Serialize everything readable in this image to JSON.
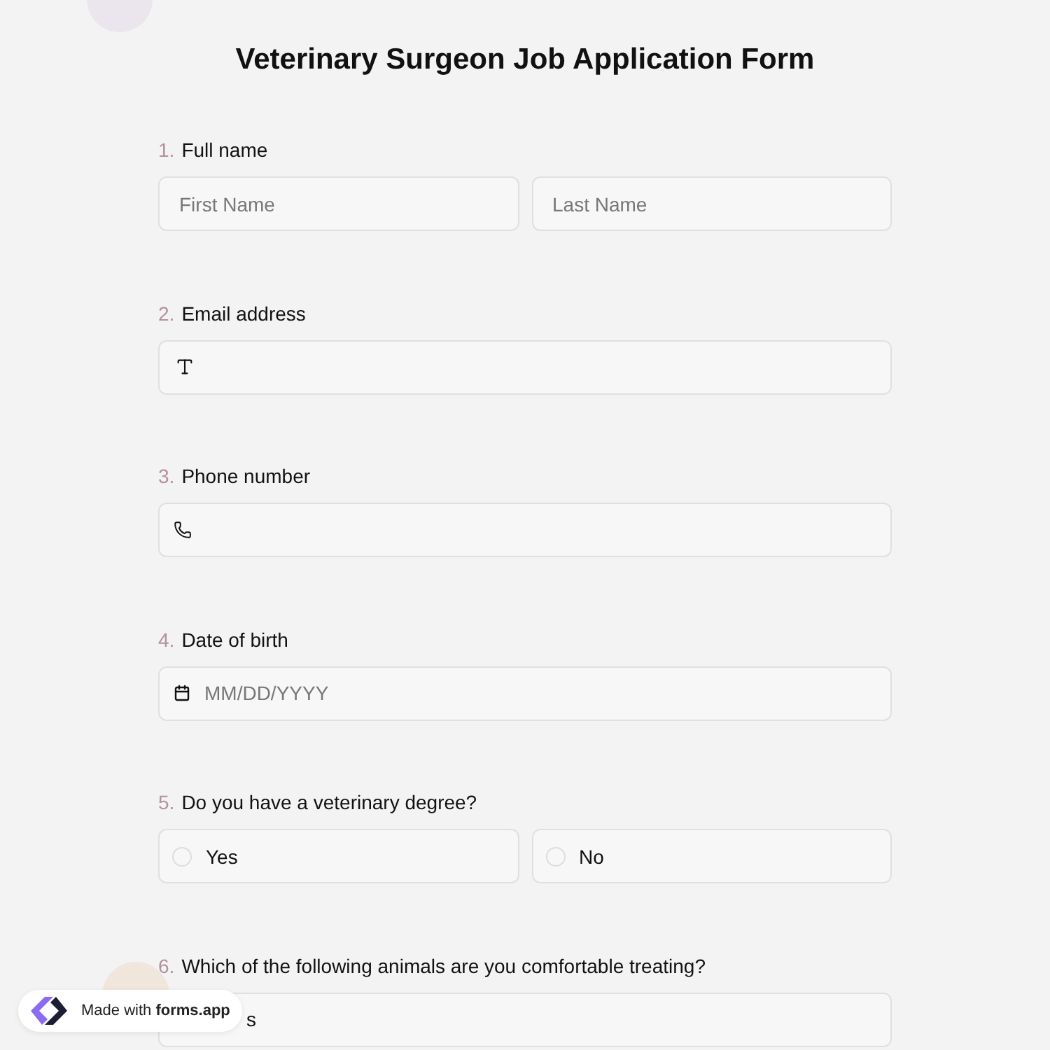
{
  "title": "Veterinary Surgeon Job Application Form",
  "questions": [
    {
      "number": "1.",
      "label": "Full name",
      "kind": "name",
      "placeholders": [
        "First Name",
        "Last Name"
      ]
    },
    {
      "number": "2.",
      "label": "Email address",
      "kind": "email"
    },
    {
      "number": "3.",
      "label": "Phone number",
      "kind": "phone"
    },
    {
      "number": "4.",
      "label": "Date of birth",
      "kind": "date",
      "placeholder": "MM/DD/YYYY"
    },
    {
      "number": "5.",
      "label": "Do you have a veterinary degree?",
      "kind": "radio",
      "options": [
        {
          "label": "Yes",
          "selected": false
        },
        {
          "label": "No",
          "selected": false
        }
      ]
    },
    {
      "number": "6.",
      "label": "Which of the following animals are you comfortable treating?",
      "kind": "choice",
      "visible_text": "s"
    }
  ],
  "badge": "Made with **forms.app**"
}
